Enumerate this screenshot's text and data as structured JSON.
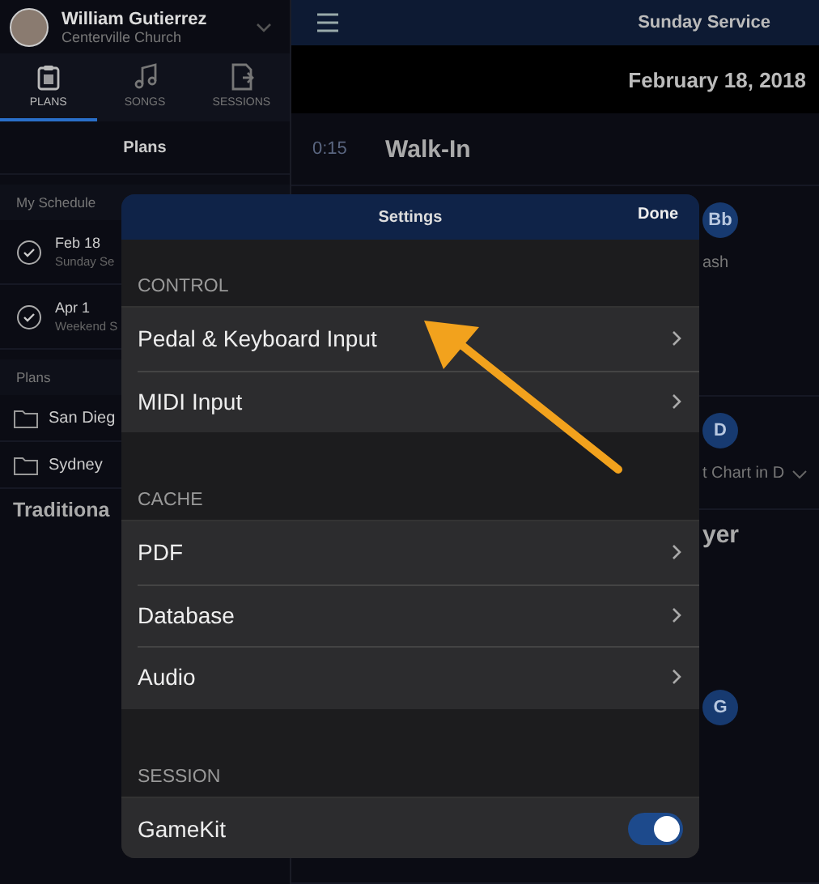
{
  "sidebar": {
    "user": {
      "name": "William Gutierrez",
      "organization": "Centerville Church"
    },
    "tabs": [
      {
        "label": "PLANS",
        "selected": true
      },
      {
        "label": "SONGS",
        "selected": false
      },
      {
        "label": "SESSIONS",
        "selected": false
      }
    ],
    "title": "Plans",
    "sections": [
      {
        "header": "My Schedule",
        "items": [
          {
            "kind": "plan",
            "date": "Feb 18",
            "subtitle": "Sunday Se"
          },
          {
            "kind": "plan",
            "date": "Apr 1",
            "subtitle": "Weekend S"
          }
        ]
      },
      {
        "header": "Plans",
        "items": [
          {
            "kind": "folder",
            "label": "San Dieg"
          },
          {
            "kind": "folder",
            "label": "Sydney"
          },
          {
            "kind": "heading",
            "label": "Traditiona"
          }
        ]
      }
    ]
  },
  "main": {
    "title": "Sunday Service",
    "date": "February 18, 2018",
    "rows": [
      {
        "kind": "item",
        "time": "0:15",
        "title": "Walk-In"
      },
      {
        "kind": "song",
        "key": "Bb",
        "note": "ash"
      },
      {
        "kind": "song",
        "key": "D",
        "note": "t Chart in D"
      },
      {
        "kind": "title",
        "title": "yer"
      },
      {
        "kind": "song",
        "key": "G"
      }
    ]
  },
  "settings": {
    "title": "Settings",
    "done": "Done",
    "sections": [
      {
        "header": "CONTROL",
        "items": [
          {
            "kind": "link",
            "label": "Pedal & Keyboard Input"
          },
          {
            "kind": "link",
            "label": "MIDI Input"
          }
        ]
      },
      {
        "header": "CACHE",
        "items": [
          {
            "kind": "link",
            "label": "PDF"
          },
          {
            "kind": "link",
            "label": "Database"
          },
          {
            "kind": "link",
            "label": "Audio"
          }
        ]
      },
      {
        "header": "SESSION",
        "items": [
          {
            "kind": "toggle",
            "label": "GameKit",
            "on": true
          }
        ]
      }
    ]
  }
}
